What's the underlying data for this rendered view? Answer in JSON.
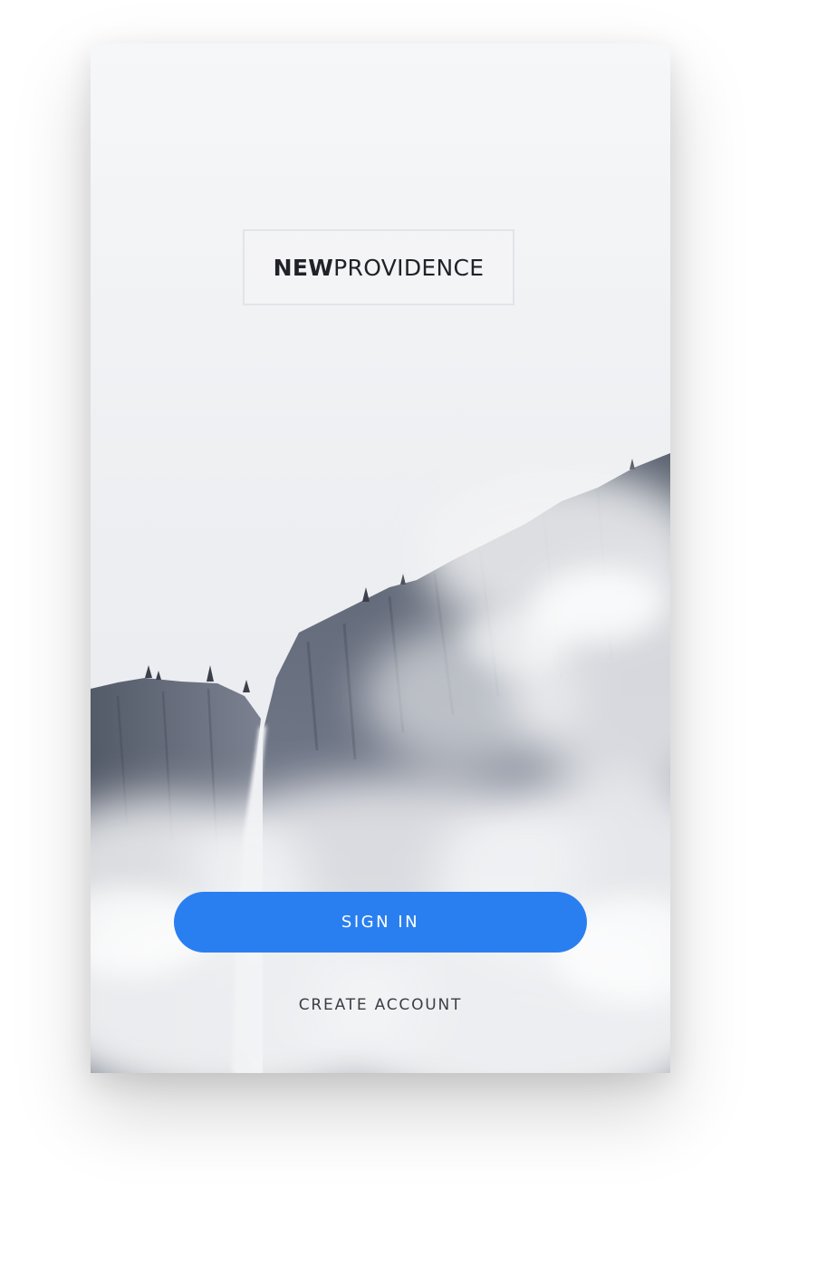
{
  "brand": {
    "name_bold": "NEW",
    "name_light": "PROVIDENCE"
  },
  "actions": {
    "sign_in_label": "SIGN IN",
    "create_account_label": "CREATE ACCOUNT"
  },
  "colors": {
    "accent": "#2a7ff0",
    "logo_text": "#1f2228",
    "link_text": "#3a3d44"
  },
  "background": {
    "subject": "misty-mountain-waterfall-photo"
  }
}
